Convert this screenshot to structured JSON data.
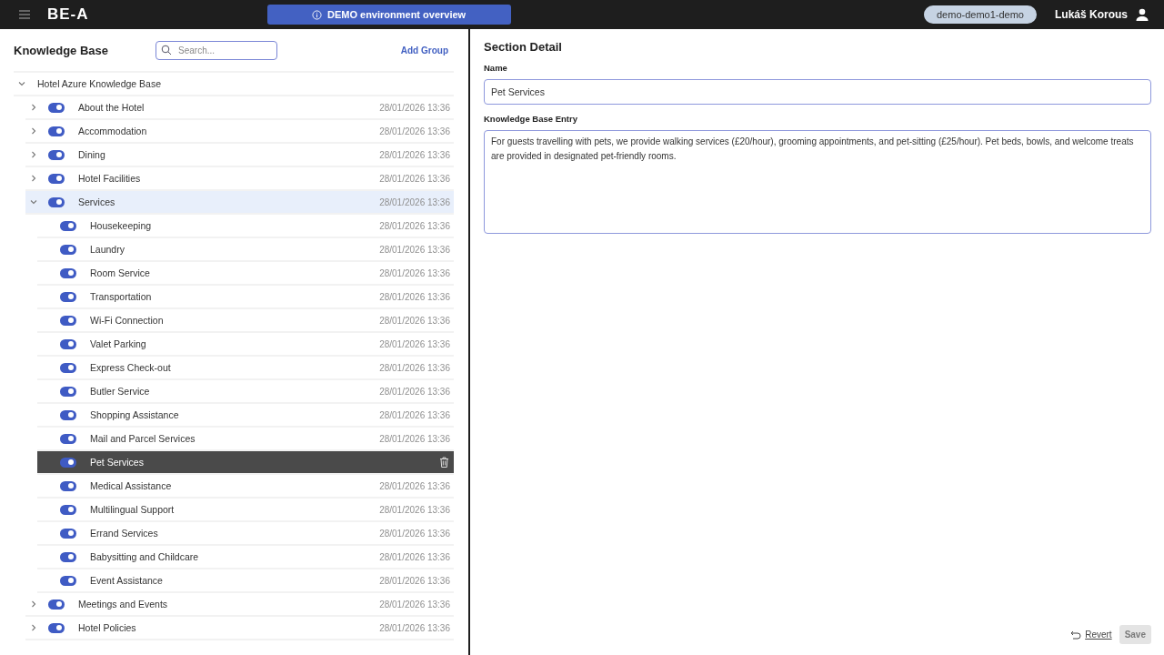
{
  "top_bar": {
    "logo": "BE-A",
    "banner": "DEMO environment overview",
    "tenant": "demo-demo1-demo",
    "user": "Lukáš Korous"
  },
  "knowledge_base": {
    "title": "Knowledge Base",
    "search": {
      "placeholder": "Search..."
    },
    "add_button": "Add Group",
    "tree": {
      "label": "Hotel Azure Knowledge Base",
      "expanded": true,
      "children": [
        {
          "label": "About the Hotel",
          "on": true,
          "expanded": false,
          "date": "28/01/2026 13:36"
        },
        {
          "label": "Accommodation",
          "on": true,
          "expanded": false,
          "date": "28/01/2026 13:36"
        },
        {
          "label": "Dining",
          "on": true,
          "expanded": false,
          "date": "28/01/2026 13:36"
        },
        {
          "label": "Hotel Facilities",
          "on": true,
          "expanded": false,
          "date": "28/01/2026 13:36"
        },
        {
          "label": "Services",
          "on": true,
          "expanded": true,
          "date": "28/01/2026 13:36",
          "children": [
            {
              "label": "Housekeeping",
              "on": true,
              "selected": false,
              "date": "28/01/2026 13:36"
            },
            {
              "label": "Laundry",
              "on": true,
              "selected": false,
              "date": "28/01/2026 13:36"
            },
            {
              "label": "Room Service",
              "on": true,
              "selected": false,
              "date": "28/01/2026 13:36"
            },
            {
              "label": "Transportation",
              "on": true,
              "selected": false,
              "date": "28/01/2026 13:36"
            },
            {
              "label": "Wi-Fi Connection",
              "on": true,
              "selected": false,
              "date": "28/01/2026 13:36"
            },
            {
              "label": "Valet Parking",
              "on": true,
              "selected": false,
              "date": "28/01/2026 13:36"
            },
            {
              "label": "Express Check-out",
              "on": true,
              "selected": false,
              "date": "28/01/2026 13:36"
            },
            {
              "label": "Butler Service",
              "on": true,
              "selected": false,
              "date": "28/01/2026 13:36"
            },
            {
              "label": "Shopping Assistance",
              "on": true,
              "selected": false,
              "date": "28/01/2026 13:36"
            },
            {
              "label": "Mail and Parcel Services",
              "on": true,
              "selected": false,
              "date": "28/01/2026 13:36"
            },
            {
              "label": "Pet Services",
              "on": true,
              "selected": true
            },
            {
              "label": "Medical Assistance",
              "on": true,
              "selected": false,
              "date": "28/01/2026 13:36"
            },
            {
              "label": "Multilingual Support",
              "on": true,
              "selected": false,
              "date": "28/01/2026 13:36"
            },
            {
              "label": "Errand Services",
              "on": true,
              "selected": false,
              "date": "28/01/2026 13:36"
            },
            {
              "label": "Babysitting and Childcare",
              "on": true,
              "selected": false,
              "date": "28/01/2026 13:36"
            },
            {
              "label": "Event Assistance",
              "on": true,
              "selected": false,
              "date": "28/01/2026 13:36"
            }
          ]
        },
        {
          "label": "Meetings and Events",
          "on": true,
          "expanded": false,
          "date": "28/01/2026 13:36"
        },
        {
          "label": "Hotel Policies",
          "on": true,
          "expanded": false,
          "date": "28/01/2026 13:36"
        }
      ]
    }
  },
  "section_detail": {
    "title": "Section Detail",
    "name_label": "Name",
    "name_value": "Pet Services",
    "entry_label": "Knowledge Base Entry",
    "entry_value": "For guests travelling with pets, we provide walking services (£20/hour), grooming appointments, and pet-sitting (£25/hour). Pet beds, bowls, and welcome treats are provided in designated pet-friendly rooms.",
    "revert_button": "Revert",
    "save_button": {
      "label": "Save",
      "disabled": true
    }
  }
}
